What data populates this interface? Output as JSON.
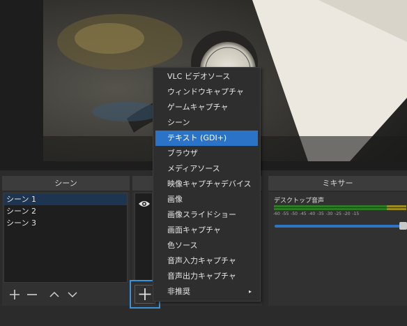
{
  "panels": {
    "scenes_title": "シーン",
    "sources_title": "",
    "mixer_title": "ミキサー"
  },
  "scenes": {
    "items": [
      "シーン 1",
      "シーン 2",
      "シーン 3"
    ],
    "selected_index": 0
  },
  "scene_toolbar": {
    "add": "+",
    "remove": "−",
    "up": "∧",
    "down": "∨"
  },
  "sources": {
    "add_button": "+",
    "visibility_icon": "eye-icon"
  },
  "mixer": {
    "track_label": "デスクトップ音声",
    "ticks": [
      "-60",
      "-55",
      "-50",
      "-45",
      "-40",
      "-35",
      "-30",
      "-25",
      "-20",
      "-15"
    ],
    "volume_fraction": 1.0,
    "colors": {
      "meter_green": "#2f7a25",
      "meter_yellow": "#9a8a22",
      "slider": "#2d75c4"
    }
  },
  "context_menu": {
    "items": [
      {
        "label": "VLC ビデオソース"
      },
      {
        "label": "ウィンドウキャプチャ"
      },
      {
        "label": "ゲームキャプチャ"
      },
      {
        "label": "シーン"
      },
      {
        "label": "テキスト (GDI+)",
        "highlighted": true
      },
      {
        "label": "ブラウザ"
      },
      {
        "label": "メディアソース"
      },
      {
        "label": "映像キャプチャデバイス"
      },
      {
        "label": "画像"
      },
      {
        "label": "画像スライドショー"
      },
      {
        "label": "画面キャプチャ"
      },
      {
        "label": "色ソース"
      },
      {
        "label": "音声入力キャプチャ"
      },
      {
        "label": "音声出力キャプチャ"
      },
      {
        "label": "非推奨",
        "submenu": true
      }
    ],
    "highlight_color": "#2a73c6",
    "submenu_arrow": "▸"
  }
}
